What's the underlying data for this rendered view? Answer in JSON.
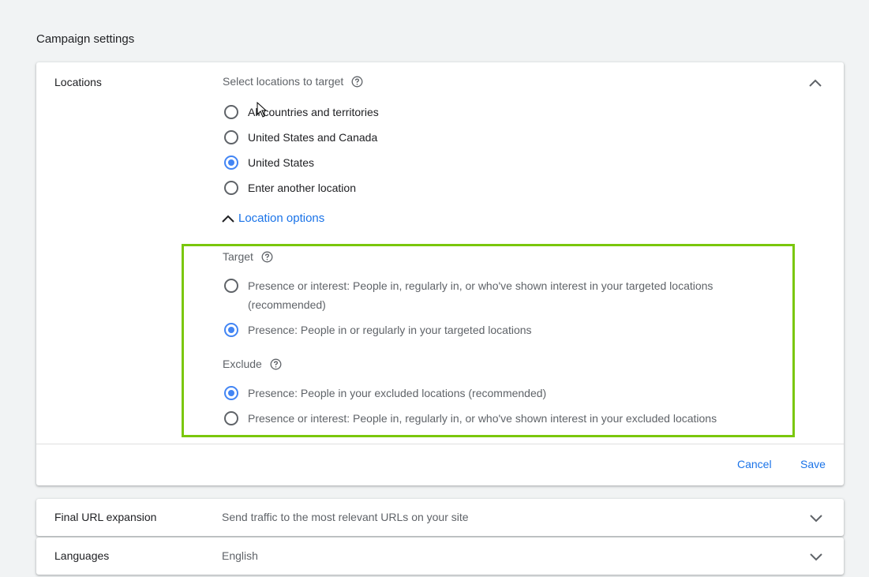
{
  "page": {
    "section_title": "Campaign settings"
  },
  "locations": {
    "label": "Locations",
    "select_label": "Select locations to target",
    "options": [
      {
        "label": "All countries and territories",
        "selected": false
      },
      {
        "label": "United States and Canada",
        "selected": false
      },
      {
        "label": "United States",
        "selected": true
      },
      {
        "label": "Enter another location",
        "selected": false
      }
    ],
    "location_options_label": "Location options",
    "target": {
      "label": "Target",
      "options": [
        {
          "label_line1": "Presence or interest: People in, regularly in, or who've shown interest in your targeted locations",
          "label_line2": "(recommended)",
          "selected": false
        },
        {
          "label_line1": "Presence: People in or regularly in your targeted locations",
          "selected": true
        }
      ]
    },
    "exclude": {
      "label": "Exclude",
      "options": [
        {
          "label_line1": "Presence: People in your excluded locations (recommended)",
          "selected": true
        },
        {
          "label_line1": "Presence or interest: People in, regularly in, or who've shown interest in your excluded locations",
          "selected": false
        }
      ]
    },
    "cancel_label": "Cancel",
    "save_label": "Save"
  },
  "final_url": {
    "label": "Final URL expansion",
    "summary": "Send traffic to the most relevant URLs on your site"
  },
  "languages": {
    "label": "Languages",
    "summary": "English"
  },
  "colors": {
    "accent": "#1a73e8",
    "radio_checked": "#4285f4",
    "highlight_border": "#7ac70c",
    "background": "#f1f3f4"
  }
}
